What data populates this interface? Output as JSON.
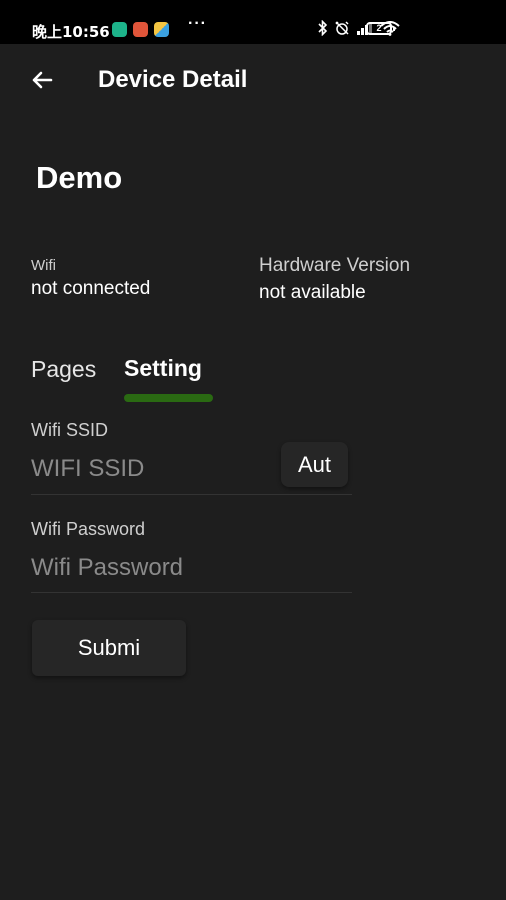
{
  "status_bar": {
    "time": "晚上10:56",
    "more": "···",
    "battery": "2"
  },
  "header": {
    "title": "Device Detail",
    "back_icon": "arrow-left-icon"
  },
  "device": {
    "name": "Demo",
    "wifi_label": "Wifi",
    "wifi_value": "not connected",
    "hardware_label": "Hardware Version",
    "hardware_value": "not available"
  },
  "tabs": [
    {
      "label": "Pages",
      "active": false
    },
    {
      "label": "Setting",
      "active": true
    }
  ],
  "form": {
    "ssid_label": "Wifi SSID",
    "ssid_placeholder": "WIFI SSID",
    "ssid_value": "",
    "auto_button": "Aut",
    "password_label": "Wifi Password",
    "password_placeholder": "Wifi Password",
    "password_value": "",
    "submit_button": "Submi"
  },
  "colors": {
    "background": "#1e1e1e",
    "status_bar": "#000000",
    "tab_indicator": "#2a6a12",
    "button_bg": "#262626"
  }
}
